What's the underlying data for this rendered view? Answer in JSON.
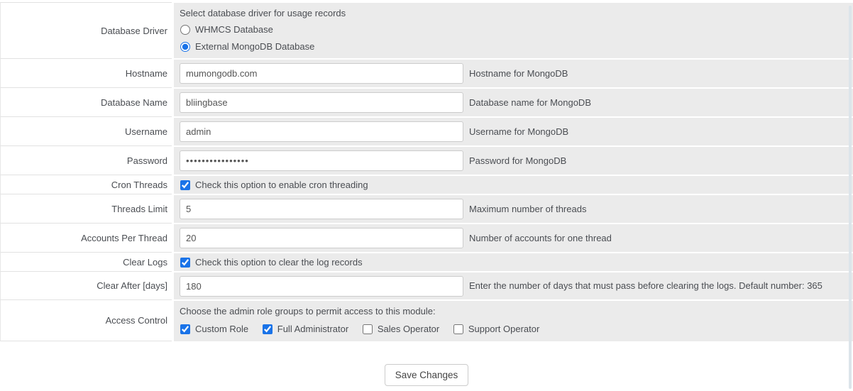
{
  "colors": {
    "control_accent": "#1a73e8",
    "field_column_bg": "#ebebeb"
  },
  "form": {
    "rows": [
      {
        "label": "Database Driver",
        "type": "radio-group",
        "description": "Select database driver for usage records",
        "options": [
          {
            "label": "WHMCS Database",
            "checked": false
          },
          {
            "label": "External MongoDB Database",
            "checked": true
          }
        ]
      },
      {
        "label": "Hostname",
        "type": "text",
        "value": "mumongodb.com",
        "hint": "Hostname for MongoDB"
      },
      {
        "label": "Database Name",
        "type": "text",
        "value": "bliingbase",
        "hint": "Database name for MongoDB"
      },
      {
        "label": "Username",
        "type": "text",
        "value": "admin",
        "hint": "Username for MongoDB"
      },
      {
        "label": "Password",
        "type": "password-masked",
        "value": "••••••••••••••••",
        "hint": "Password for MongoDB"
      },
      {
        "label": "Cron Threads",
        "type": "checkbox",
        "checked": true,
        "text": "Check this option to enable cron threading"
      },
      {
        "label": "Threads Limit",
        "type": "text",
        "value": "5",
        "hint": "Maximum number of threads"
      },
      {
        "label": "Accounts Per Thread",
        "type": "text",
        "value": "20",
        "hint": "Number of accounts for one thread"
      },
      {
        "label": "Clear Logs",
        "type": "checkbox",
        "checked": true,
        "text": "Check this option to clear the log records"
      },
      {
        "label": "Clear After [days]",
        "type": "text",
        "value": "180",
        "hint": "Enter the number of days that must pass before clearing the logs. Default number: 365"
      },
      {
        "label": "Access Control",
        "type": "checkbox-group",
        "description": "Choose the admin role groups to permit access to this module:",
        "options": [
          {
            "label": "Custom Role",
            "checked": true
          },
          {
            "label": "Full Administrator",
            "checked": true
          },
          {
            "label": "Sales Operator",
            "checked": false
          },
          {
            "label": "Support Operator",
            "checked": false
          }
        ]
      }
    ],
    "save_button": "Save Changes"
  }
}
